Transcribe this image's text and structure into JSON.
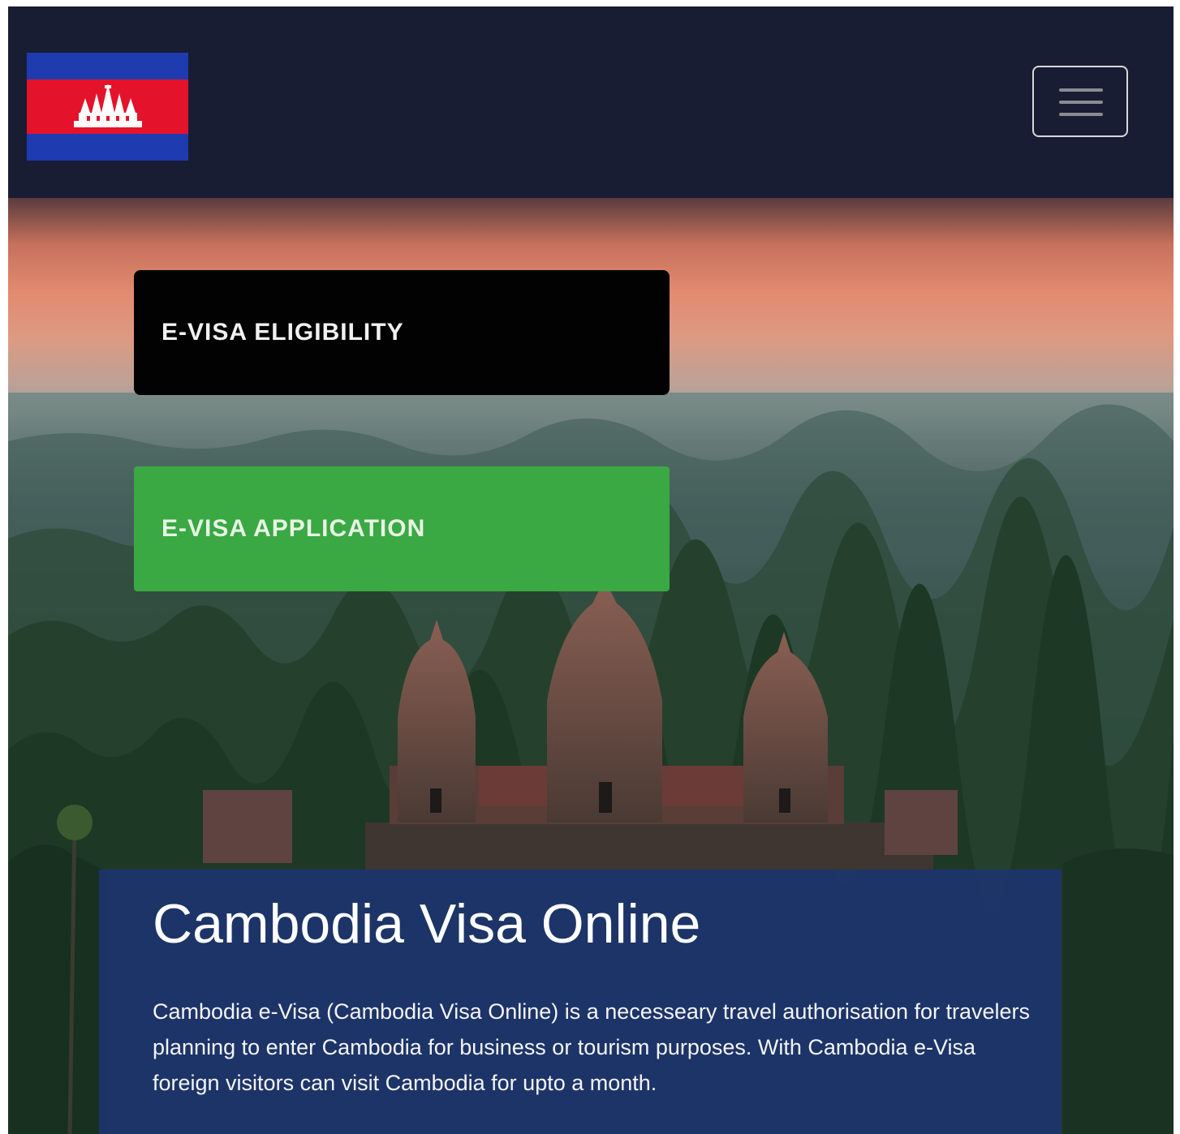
{
  "header": {
    "logo": {
      "icon": "cambodia-flag-icon",
      "colors": {
        "blue": "#1f3bb0",
        "red": "#e4122a",
        "temple": "#ffffff"
      }
    },
    "menu_icon": "hamburger-menu-icon"
  },
  "hero": {
    "background": "angkor-wat-temple-at-sunrise",
    "buttons": {
      "eligibility_label": "E-VISA ELIGIBILITY",
      "application_label": "E-VISA APPLICATION"
    }
  },
  "info": {
    "title": "Cambodia Visa Online",
    "description": "Cambodia e-Visa (Cambodia Visa Online) is a necesseary travel authorisation for travelers planning to enter Cambodia for business or tourism purposes. With Cambodia e-Visa foreign visitors can visit Cambodia for upto a month."
  },
  "colors": {
    "navbar": "#181d34",
    "eligibility_button": "#020202",
    "application_button": "#3aa843",
    "info_box": "#1d346e"
  }
}
